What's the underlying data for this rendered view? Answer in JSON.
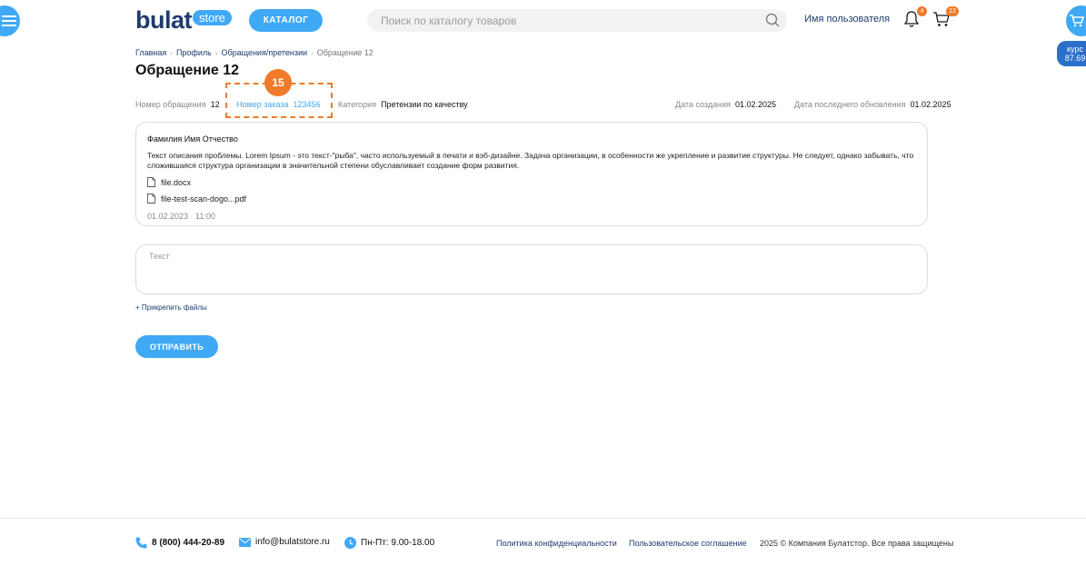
{
  "header": {
    "logo_main": "bulat",
    "logo_badge": "store",
    "catalog_label": "КАТАЛОГ",
    "search_placeholder": "Поиск по каталогу товаров",
    "username": "Имя пользователя",
    "notifications_count": "4",
    "cart_count": "12"
  },
  "rate": {
    "label": "курс",
    "value": "87.69"
  },
  "breadcrumb": [
    "Главная",
    "Профиль",
    "Обращения/претензии",
    "Обращение 12"
  ],
  "page_title": "Обращение 12",
  "meta": {
    "number_label": "Номер обращения",
    "number_value": "12",
    "order_label": "Номер заказа",
    "order_value": "123456",
    "category_label": "Категория",
    "category_value": "Претензии по качеству",
    "created_label": "Дата создания",
    "created_value": "01.02.2025",
    "updated_label": "Дата последнего обновления",
    "updated_value": "01.02.2025"
  },
  "annotation": {
    "step": "15"
  },
  "message": {
    "author": "Фамилия Имя Отчество",
    "text": "Текст описания проблемы. Lorem Ipsum - это текст-\"рыба\", часто используемый в печати и вэб-дизайне. Задача организации, в особенности же укрепление и развитие структуры. Не следует, однако забывать, что сложившаяся структура организации в значительной степени обуславливает создание форм развития.",
    "files": [
      "file.docx",
      "file-test-scan-dogo...pdf"
    ],
    "date": "01.02.2023",
    "time": "11:00"
  },
  "reply": {
    "placeholder": "Текст",
    "attach_label": "+ Прикрепить файлы",
    "send_label": "ОТПРАВИТЬ"
  },
  "footer": {
    "phone": "8 (800) 444-20-89",
    "email": "info@bulatstore.ru",
    "hours": "Пн-Пт: 9.00-18.00",
    "privacy": "Политика конфиденциальности",
    "terms": "Пользовательское соглашение",
    "copyright": "2025 © Компания Булатстор. Все права защищены"
  },
  "colors": {
    "accent": "#3fa9f5",
    "brand_dark": "#1d3c6e",
    "highlight": "#ef7b2a"
  }
}
